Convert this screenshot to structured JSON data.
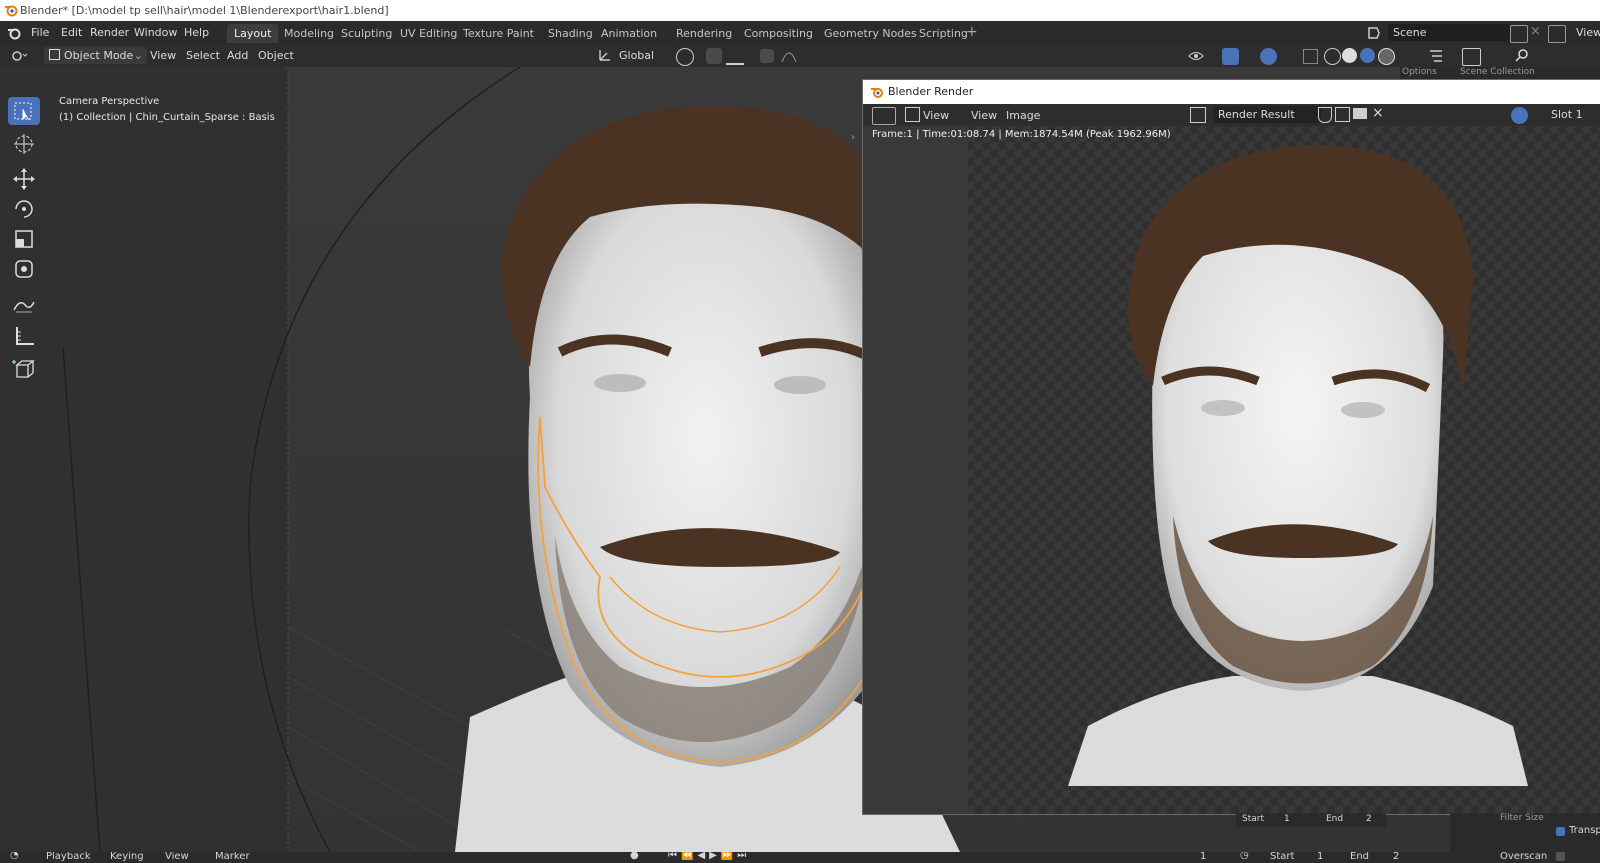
{
  "window": {
    "title": "Blender* [D:\\model tp sell\\hair\\model 1\\Blenderexport\\hair1.blend]"
  },
  "menu": [
    "File",
    "Edit",
    "Render",
    "Window",
    "Help"
  ],
  "workspaces": [
    {
      "label": "Layout",
      "active": true
    },
    {
      "label": "Modeling"
    },
    {
      "label": "Sculpting"
    },
    {
      "label": "UV Editing"
    },
    {
      "label": "Texture Paint"
    },
    {
      "label": "Shading"
    },
    {
      "label": "Animation"
    },
    {
      "label": "Rendering"
    },
    {
      "label": "Compositing"
    },
    {
      "label": "Geometry Nodes"
    },
    {
      "label": "Scripting"
    }
  ],
  "add_workspace": "+",
  "scene": {
    "label": "Scene",
    "view_layer": "ViewL"
  },
  "viewport_header": {
    "mode": "Object Mode",
    "menus": [
      "View",
      "Select",
      "Add",
      "Object"
    ],
    "orientation": "Global"
  },
  "viewport": {
    "camera_label": "Camera Perspective",
    "collection_label": "(1) Collection | Chin_Curtain_Sparse : Basis"
  },
  "render_window": {
    "title": "Blender Render",
    "menus": [
      "View",
      "View",
      "Image"
    ],
    "image_name": "Render Result",
    "slot": "Slot 1",
    "stats": "Frame:1 | Time:01:08.74 | Mem:1874.54M (Peak 1962.96M)"
  },
  "right_panel": {
    "options": "Options",
    "scene_collection": "Scene Collection",
    "filter_size": "Filter Size",
    "transparent": "Transpa",
    "overscan": "Overscan"
  },
  "frame_range_panel": {
    "start_label": "Start",
    "start": "1",
    "end_label": "End",
    "end": "2"
  },
  "timeline": {
    "menus": [
      "Playback",
      "Keying",
      "View",
      "Marker"
    ],
    "current_frame": "1",
    "start_label": "Start",
    "start": "1",
    "end_label": "End",
    "end": "2"
  },
  "colors": {
    "accent": "#4a72b8",
    "selection_outline": "#f5a03c",
    "hair": "#4a3323",
    "skin": "#e6e6e6"
  }
}
